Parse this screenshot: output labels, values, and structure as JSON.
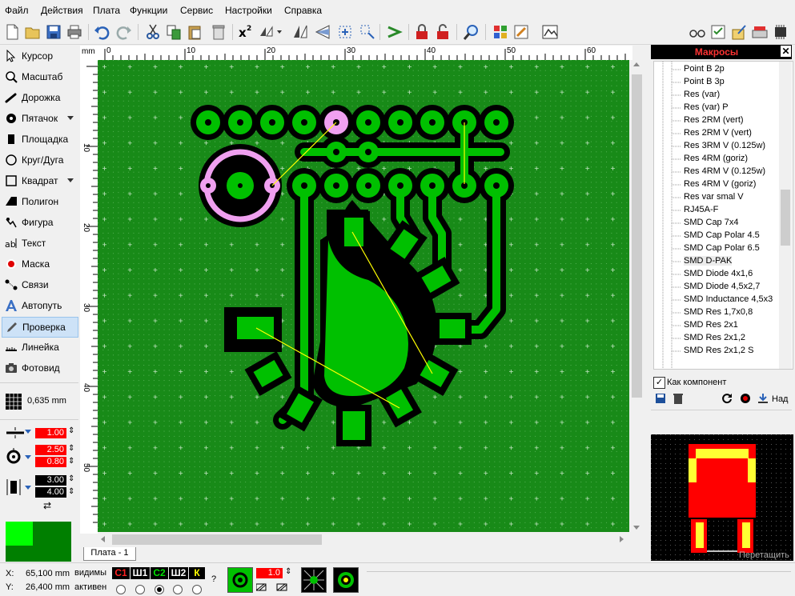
{
  "menu": [
    "Файл",
    "Действия",
    "Плата",
    "Функции",
    "Сервис",
    "Настройки",
    "Справка"
  ],
  "toolbar": {
    "icons": [
      "new-icon",
      "open-icon",
      "save-icon",
      "print-icon",
      "undo-icon",
      "redo-icon",
      "cut-icon",
      "copy-icon",
      "paste-icon",
      "delete-icon",
      "x2-icon",
      "mirror-h-icon",
      "mirror-v1-icon",
      "mirror-v2-icon",
      "rotate-icon",
      "align-icon",
      "route-icon",
      "lock-icon",
      "unlock-icon",
      "zoom-icon",
      "component-icon",
      "edit-icon",
      "photo-icon",
      "glasses-icon",
      "checklist-icon",
      "export-icon",
      "scanner-icon",
      "chip-icon"
    ]
  },
  "tools": [
    {
      "label": "Курсор",
      "icon": "cursor-icon"
    },
    {
      "label": "Масштаб",
      "icon": "zoom-icon"
    },
    {
      "label": "Дорожка",
      "icon": "track-icon"
    },
    {
      "label": "Пятачок",
      "icon": "pad-icon"
    },
    {
      "label": "Площадка",
      "icon": "smd-pad-icon"
    },
    {
      "label": "Круг/Дуга",
      "icon": "circle-icon"
    },
    {
      "label": "Квадрат",
      "icon": "square-icon"
    },
    {
      "label": "Полигон",
      "icon": "polygon-icon"
    },
    {
      "label": "Фигура",
      "icon": "figure-icon"
    },
    {
      "label": "Текст",
      "icon": "text-icon"
    },
    {
      "label": "Маска",
      "icon": "mask-icon"
    },
    {
      "label": "Связи",
      "icon": "connections-icon"
    },
    {
      "label": "Автопуть",
      "icon": "autoroute-icon"
    },
    {
      "label": "Проверка",
      "icon": "check-icon"
    },
    {
      "label": "Линейка",
      "icon": "ruler-icon"
    },
    {
      "label": "Фотовид",
      "icon": "photoview-icon"
    }
  ],
  "grid": {
    "value": "0,635 mm"
  },
  "params": {
    "track_width": "1.00",
    "pad_outer": "2.50",
    "pad_inner": "0.80",
    "smd_w": "3.00",
    "smd_h": "4.00"
  },
  "ruler": {
    "unit": "mm",
    "top_ticks": [
      "0",
      "10",
      "20",
      "30",
      "40",
      "50",
      "60"
    ],
    "left_ticks": [
      "10",
      "20",
      "30",
      "40",
      "50"
    ]
  },
  "board_tab": "Плата - 1",
  "macros": {
    "title": "Макросы",
    "items": [
      "Point B 2p",
      "Point B 3p",
      "Res (var)",
      "Res (var) P",
      "Res 2RM (vert)",
      "Res 2RM V (vert)",
      "Res 3RM V (0.125w)",
      "Res 4RM (goriz)",
      "Res 4RM V (0.125w)",
      "Res 4RM V (goriz)",
      "Res var smal V",
      "RJ45A-F",
      "SMD Cap 7x4",
      "SMD Cap Polar 4.5",
      "SMD Cap Polar 6.5",
      "SMD D-PAK",
      "SMD Diode 4x1,6",
      "SMD Diode 4,5x2,7",
      "SMD Inductance 4,5x3",
      "SMD Res 1,7x0,8",
      "SMD Res 2x1",
      "SMD Res 2x1,2",
      "SMD Res 2x1,2 S"
    ],
    "selected": "SMD D-PAK",
    "as_component": "Как компонент",
    "on_label": "Над",
    "drag_hint": "Перетащить"
  },
  "status": {
    "x_label": "X:",
    "x_value": "65,100 mm",
    "y_label": "Y:",
    "y_value": "26,400 mm",
    "visible": "видимы",
    "active": "активен",
    "layers": [
      "С1",
      "Ш1",
      "С2",
      "Ш2",
      "К"
    ],
    "help": "?",
    "flash_value": "1.0"
  },
  "colors": {
    "board": "#188a18",
    "copper": "#00c000",
    "pink": "#f0a0f0",
    "ratsnest": "#ffff00",
    "mask": "#000000"
  }
}
